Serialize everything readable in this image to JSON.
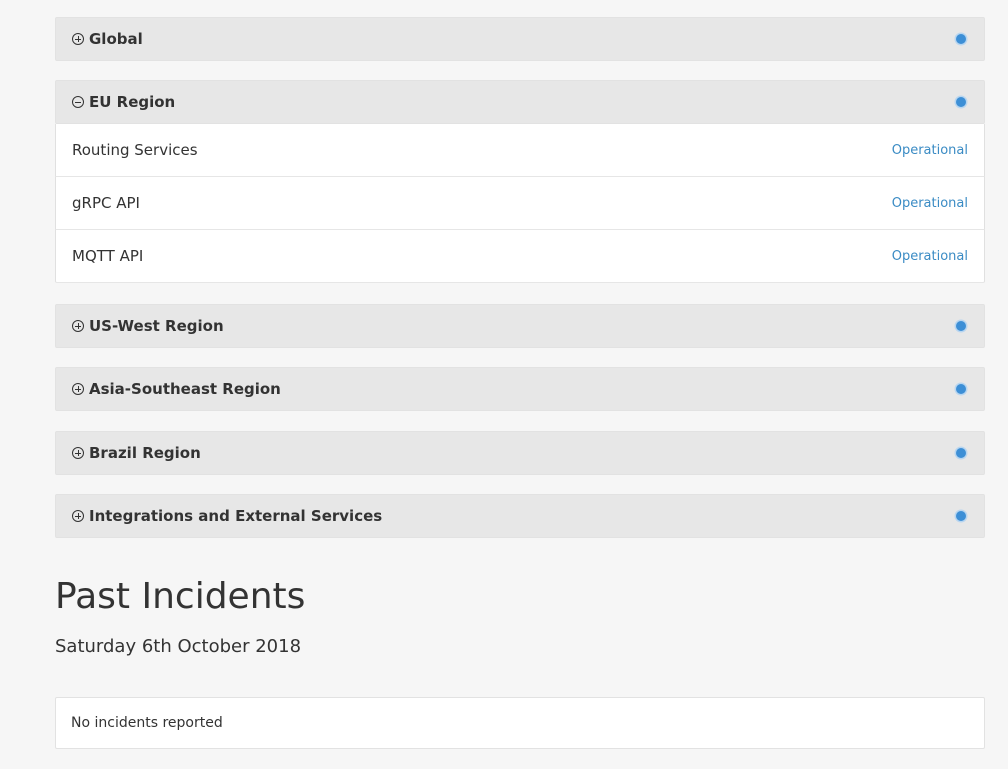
{
  "groups": [
    {
      "name": "Global",
      "expanded": false
    },
    {
      "name": "EU Region",
      "expanded": true,
      "components": [
        {
          "name": "Routing Services",
          "status": "Operational"
        },
        {
          "name": "gRPC API",
          "status": "Operational"
        },
        {
          "name": "MQTT API",
          "status": "Operational"
        }
      ]
    },
    {
      "name": "US-West Region",
      "expanded": false
    },
    {
      "name": "Asia-Southeast Region",
      "expanded": false
    },
    {
      "name": "Brazil Region",
      "expanded": false
    },
    {
      "name": "Integrations and External Services",
      "expanded": false
    }
  ],
  "status_color": "#3d8fd6",
  "operational_text_color": "#3a8bc4",
  "past_incidents": {
    "title": "Past Incidents",
    "date": "Saturday 6th October 2018",
    "message": "No incidents reported"
  }
}
